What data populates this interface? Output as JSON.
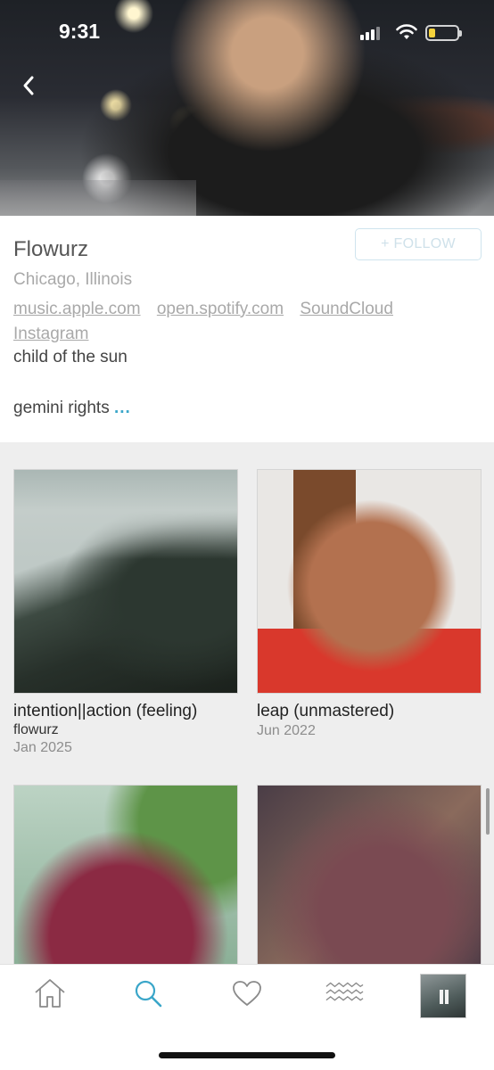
{
  "status_bar": {
    "time": "9:31",
    "battery_level": 0.22,
    "battery_color": "#f5d23c"
  },
  "icons": {
    "back": "chevron-left-icon",
    "home": "home-icon",
    "search": "search-icon",
    "favorites": "heart-icon",
    "feed": "waves-icon"
  },
  "profile": {
    "name": "Flowurz",
    "follow_label": "+ FOLLOW",
    "location": "Chicago, Illinois",
    "links": [
      "music.apple.com",
      "open.spotify.com",
      "SoundCloud",
      "Instagram"
    ],
    "bio_line1": "child of the sun",
    "bio_line2": "gemini rights",
    "more_label": "..."
  },
  "releases": [
    {
      "title": "intention||action (feeling)",
      "artist": "flowurz",
      "date": "Jan 2025"
    },
    {
      "title": "leap (unmastered)",
      "artist": "",
      "date": "Jun 2022"
    },
    {
      "title": "",
      "artist": "",
      "date": ""
    },
    {
      "title": "",
      "artist": "",
      "date": ""
    }
  ],
  "tabbar": {
    "active_tab": "search",
    "accent_color": "#3aa6c9"
  }
}
